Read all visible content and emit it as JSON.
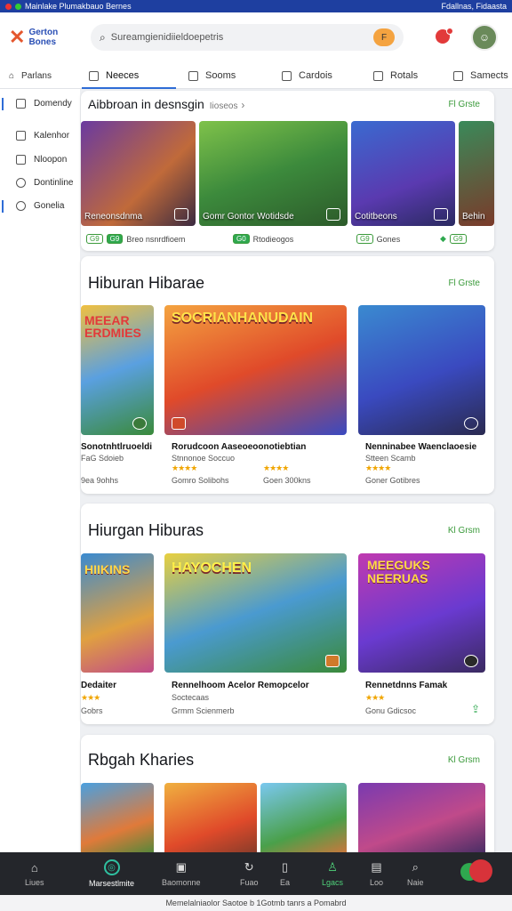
{
  "status_bar": {
    "left_text": "Mainlake Plumakbauo Bernes",
    "right_text": "Fdallnas, Fidaasta"
  },
  "app": {
    "logo_text_1": "Gerton",
    "logo_text_2": "Bones"
  },
  "search": {
    "placeholder": "Sureamgienidiieldoepetris",
    "badge": "F"
  },
  "tabs": [
    {
      "label": "Neeces"
    },
    {
      "label": "Sooms"
    },
    {
      "label": "Cardois"
    },
    {
      "label": "Rotals"
    },
    {
      "label": "Samects"
    }
  ],
  "sidebar": {
    "header": "Parlans",
    "items": [
      {
        "label": "Domendy"
      },
      {
        "label": "Kalenhor"
      },
      {
        "label": "Nloopon"
      },
      {
        "label": "Dontinline"
      },
      {
        "label": "Gonelia"
      }
    ]
  },
  "section1": {
    "title": "Aibbroan in desnsgin",
    "subtitle": "Iioseos",
    "link": "Fl Grste",
    "cards": [
      {
        "label": "Reneonsdnma"
      },
      {
        "label": "Gomr Gontor Wotidsde"
      },
      {
        "label": "Cotitbeons"
      },
      {
        "label": "Behin"
      }
    ],
    "chips": [
      {
        "a": "G9",
        "b": "G9",
        "text": "Breo nsnrdfioem"
      },
      {
        "a": "G0",
        "text": "Rtodieogos"
      },
      {
        "a": "G9",
        "text": "Gones"
      },
      {
        "a": "G9"
      }
    ]
  },
  "section2": {
    "title": "Hiburan Hibarae",
    "link": "Fl Grste",
    "games": [
      {
        "art": "MEEAR ERDMIES",
        "title": "Sonotnhtlruoeldi",
        "meta": "FaG Sdoieb",
        "extra": "9ea 9ohhs"
      },
      {
        "art": "SOCRIANHANUDAIN",
        "title": "Rorudcoon Aaseoeoonotiebtian",
        "meta": "Stnnonoe Soccuo",
        "rating": "★★★★",
        "extra": "Gomro Solibohs"
      },
      {
        "art": "",
        "title": "Nenninabee Waenclaoesie",
        "meta": "Stteen Scamb",
        "rating": "★★★★",
        "extra": "Goner Gotibres"
      }
    ],
    "sub_meta": "Goen 300kns"
  },
  "section3": {
    "title": "Hiurgan Hiburas",
    "link": "Kl Grsm",
    "games": [
      {
        "art": "HIIKINS",
        "title": "Dedaiter",
        "rating": "★★★",
        "extra": "Gobrs"
      },
      {
        "art": "HAYOCHEN",
        "title": "Rennelhoom Acelor Remopcelor",
        "meta": "Soctecaas",
        "extra": "Grmm Scienmerb"
      },
      {
        "art": "MEEGUKS NEERUAS",
        "title": "Rennetdnns Famak",
        "rating": "★★★",
        "extra": "Gonu Gdicsoc"
      }
    ]
  },
  "section4": {
    "title": "Rbgah Kharies",
    "link": "Kl Grsm"
  },
  "bottom_nav": [
    {
      "label": "Liues"
    },
    {
      "label": "Marsestlmite"
    },
    {
      "label": "Baomonne"
    },
    {
      "label": "Fuao"
    },
    {
      "label": "Ea"
    },
    {
      "label": "Lgacs"
    },
    {
      "label": "Loo"
    },
    {
      "label": "Naie"
    }
  ],
  "footer": "Memelalniaolor Saotoe b 1Gotmb tanrs a Pomabrd"
}
